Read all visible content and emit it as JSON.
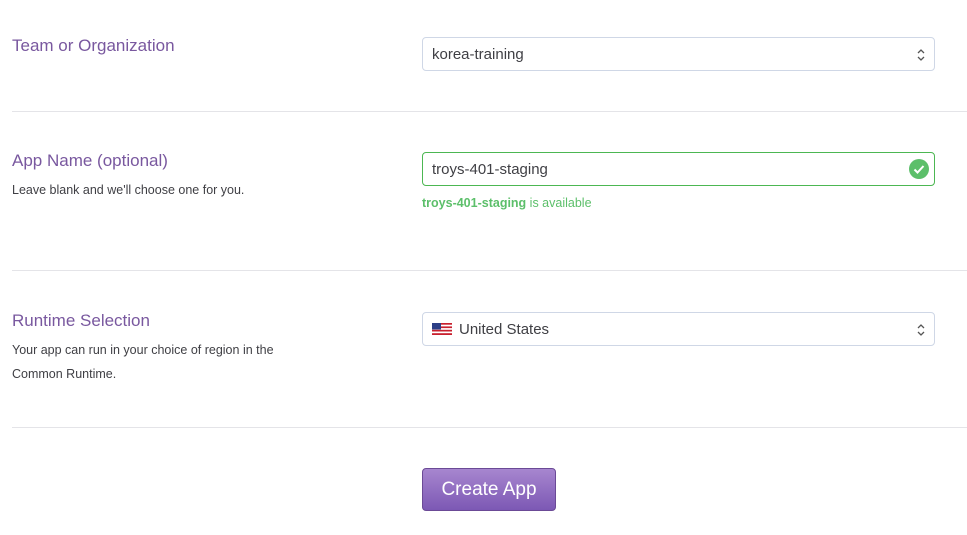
{
  "team": {
    "label": "Team or Organization",
    "selected": "korea-training"
  },
  "app_name": {
    "label": "App Name (optional)",
    "help": "Leave blank and we'll choose one for you.",
    "value": "troys-401-staging",
    "availability_name": "troys-401-staging",
    "availability_text": " is available"
  },
  "runtime": {
    "label": "Runtime Selection",
    "help": "Your app can run in your choice of region in the Common Runtime.",
    "selected": "United States",
    "flag_icon": "us-flag-icon"
  },
  "create_button": {
    "label": "Create App"
  },
  "colors": {
    "label": "#79589f",
    "valid": "#5cbf6a",
    "button": "#8f6bc2"
  }
}
